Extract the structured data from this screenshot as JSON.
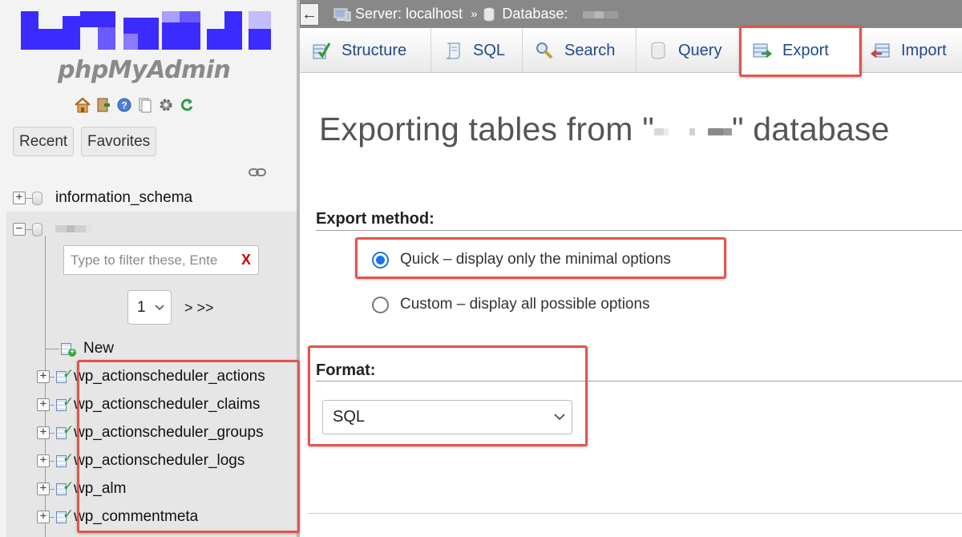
{
  "app": {
    "logo_text": "phpMyAdmin"
  },
  "navigation": {
    "icons": [
      "home-icon",
      "logout-icon",
      "help-icon",
      "docs-icon",
      "settings-icon",
      "reload-icon"
    ],
    "recent_label": "Recent",
    "favorites_label": "Favorites",
    "link_icon": "link-icon",
    "databases": [
      {
        "name": "information_schema",
        "expanded": false
      }
    ],
    "filter_placeholder": "Type to filter these, Ente",
    "filter_clear": "X",
    "page_select_value": "1",
    "page_next": "> >>",
    "new_label": "New",
    "tables": [
      "wp_actionscheduler_actions",
      "wp_actionscheduler_claims",
      "wp_actionscheduler_groups",
      "wp_actionscheduler_logs",
      "wp_alm",
      "wp_commentmeta"
    ]
  },
  "breadcrumb": {
    "back_label": "←",
    "server_label": "Server: localhost",
    "separator": "»",
    "database_label": "Database:"
  },
  "tabs": [
    {
      "label": "Structure",
      "icon": "structure-icon"
    },
    {
      "label": "SQL",
      "icon": "sql-icon"
    },
    {
      "label": "Search",
      "icon": "search-icon"
    },
    {
      "label": "Query",
      "icon": "query-icon"
    },
    {
      "label": "Export",
      "icon": "export-icon",
      "active": true
    },
    {
      "label": "Import",
      "icon": "import-icon"
    }
  ],
  "main": {
    "title_prefix": "Exporting tables from \"",
    "title_suffix": "\" database",
    "export_method_label": "Export method:",
    "options": [
      {
        "label": "Quick – display only the minimal options",
        "checked": true
      },
      {
        "label": "Custom – display all possible options",
        "checked": false
      }
    ],
    "format_label": "Format:",
    "format_value": "SQL"
  },
  "colors": {
    "highlight": "#e2554d",
    "tab_text": "#1f4a8a",
    "topbar": "#888888",
    "radio_checked": "#1a73e8"
  }
}
